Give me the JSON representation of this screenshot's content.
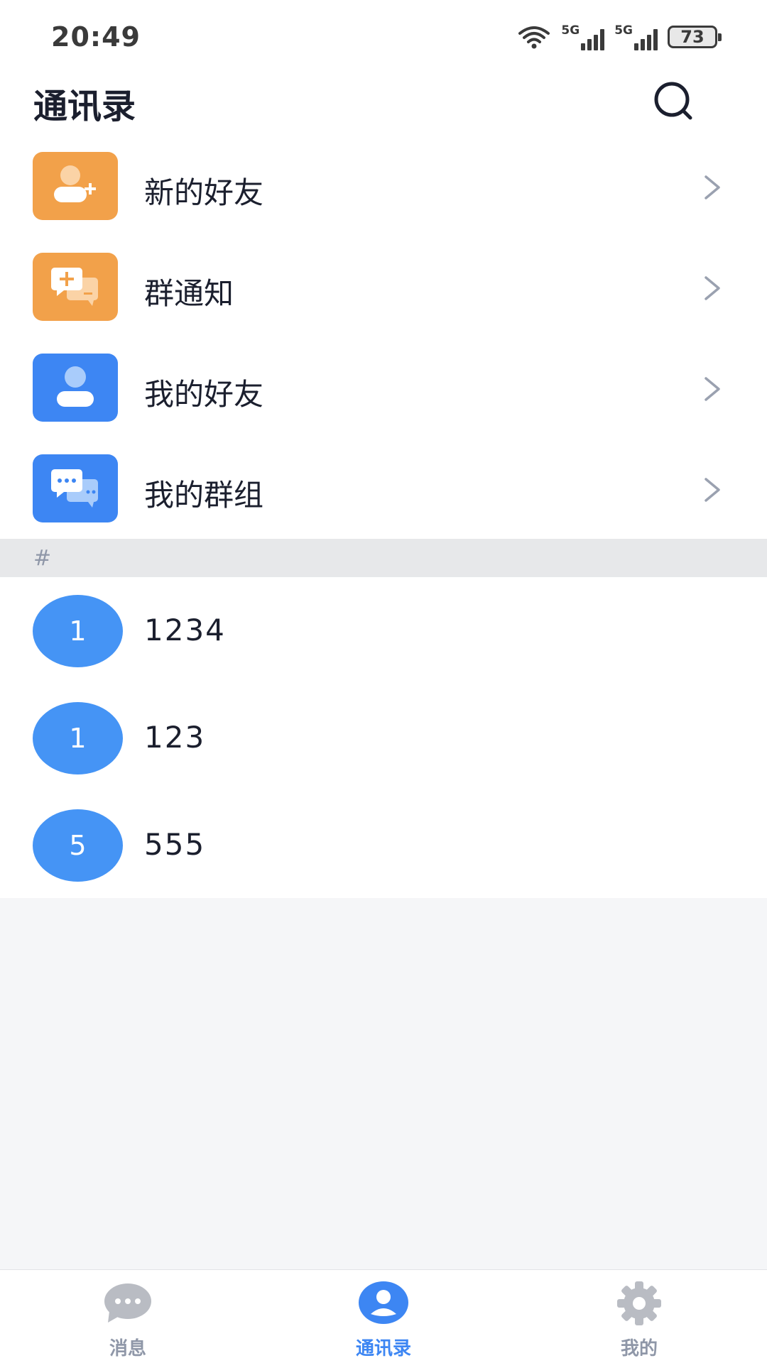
{
  "status_bar": {
    "time": "20:49",
    "network1": "5G",
    "network2": "5G",
    "battery": "73",
    "icons": [
      "wifi-icon",
      "signal-icon",
      "signal-icon",
      "battery-icon"
    ]
  },
  "header": {
    "title": "通讯录",
    "search_icon": "search-icon"
  },
  "menu": [
    {
      "label": "新的好友",
      "icon": "add-friend-icon",
      "color": "#f2a14a"
    },
    {
      "label": "群通知",
      "icon": "group-notification-icon",
      "color": "#f2a14a"
    },
    {
      "label": "我的好友",
      "icon": "friend-icon",
      "color": "#3d86f3"
    },
    {
      "label": "我的群组",
      "icon": "group-chat-icon",
      "color": "#3d86f3"
    }
  ],
  "section": {
    "letter": "#"
  },
  "contacts": [
    {
      "avatar": "1",
      "name": "1234"
    },
    {
      "avatar": "1",
      "name": "123"
    },
    {
      "avatar": "5",
      "name": "555"
    }
  ],
  "bottom_nav": {
    "items": [
      {
        "label": "消息",
        "icon": "chat-icon",
        "active": false
      },
      {
        "label": "通讯录",
        "icon": "contacts-icon",
        "active": true
      },
      {
        "label": "我的",
        "icon": "gear-icon",
        "active": false
      }
    ]
  },
  "colors": {
    "accent": "#3d86f3",
    "orange": "#f2a14a",
    "avatar": "#4594f5",
    "inactive": "#8f97a8"
  }
}
